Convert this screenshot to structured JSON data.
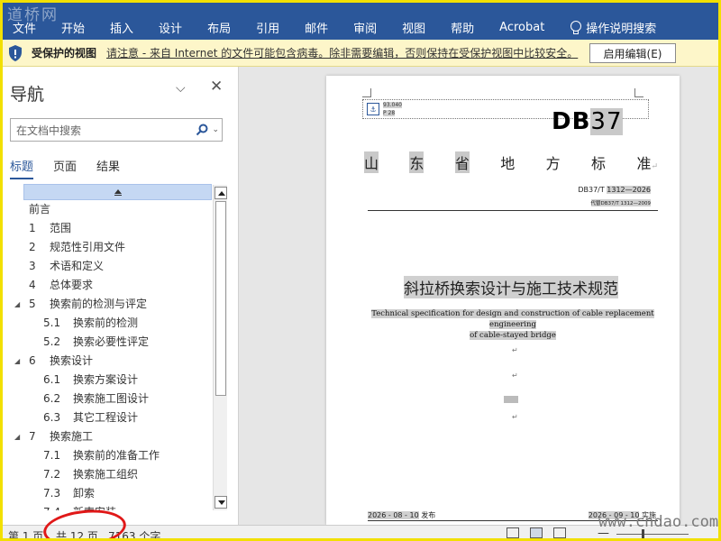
{
  "ribbon": {
    "watermark": "道桥网",
    "tabs": [
      "文件",
      "开始",
      "插入",
      "设计",
      "布局",
      "引用",
      "邮件",
      "审阅",
      "视图",
      "帮助",
      "Acrobat"
    ],
    "help_label": "操作说明搜索",
    "color": "#2b579a"
  },
  "protected_bar": {
    "title": "受保护的视图",
    "message": "请注意 - 来自 Internet 的文件可能包含病毒。除非需要编辑，否则保持在受保护视图中比较安全。",
    "button": "启用编辑(E)",
    "color": "#fdf6c9"
  },
  "nav": {
    "title": "导航",
    "search_placeholder": "在文档中搜索",
    "tabs": [
      "标题",
      "页面",
      "结果"
    ],
    "active_tab": "标题",
    "items": [
      {
        "num": "",
        "label": "前言",
        "level": 0,
        "expander": ""
      },
      {
        "num": "1",
        "label": "范围",
        "level": 0,
        "expander": ""
      },
      {
        "num": "2",
        "label": "规范性引用文件",
        "level": 0,
        "expander": ""
      },
      {
        "num": "3",
        "label": "术语和定义",
        "level": 0,
        "expander": ""
      },
      {
        "num": "4",
        "label": "总体要求",
        "level": 0,
        "expander": ""
      },
      {
        "num": "5",
        "label": "换索前的检测与评定",
        "level": 0,
        "expander": "◢"
      },
      {
        "num": "5.1",
        "label": "换索前的检测",
        "level": 1,
        "expander": ""
      },
      {
        "num": "5.2",
        "label": "换索必要性评定",
        "level": 1,
        "expander": ""
      },
      {
        "num": "6",
        "label": "换索设计",
        "level": 0,
        "expander": "◢"
      },
      {
        "num": "6.1",
        "label": "换索方案设计",
        "level": 1,
        "expander": ""
      },
      {
        "num": "6.2",
        "label": "换索施工图设计",
        "level": 1,
        "expander": ""
      },
      {
        "num": "6.3",
        "label": "其它工程设计",
        "level": 1,
        "expander": ""
      },
      {
        "num": "7",
        "label": "换索施工",
        "level": 0,
        "expander": "◢"
      },
      {
        "num": "7.1",
        "label": "换索前的准备工作",
        "level": 1,
        "expander": ""
      },
      {
        "num": "7.2",
        "label": "换索施工组织",
        "level": 1,
        "expander": ""
      },
      {
        "num": "7.3",
        "label": "卸索",
        "level": 1,
        "expander": ""
      },
      {
        "num": "7.4",
        "label": "新索安装",
        "level": 1,
        "expander": ""
      }
    ]
  },
  "document": {
    "ics": "93.040",
    "ccs": "P 28",
    "db_label": "DB",
    "db_num": "37",
    "province": [
      "山",
      "东",
      "省",
      "地",
      "方",
      "标",
      "准"
    ],
    "standard_code_prefix": "DB37/T ",
    "standard_code": "1312—2026",
    "replaces": "代替DB37/T 1312—2009",
    "cn_title": "斜拉桥换索设计与施工技术规范",
    "en_title_1": "Technical specification for design and construction of cable replacement engineering",
    "en_title_2": "of cable-stayed bridge",
    "issue_date": "2026 - 08 - 10",
    "issue_label": "发布",
    "implement_date": "2026 - 09 - 10",
    "implement_label": "实施",
    "para_mark": "↵"
  },
  "status": {
    "page": "第 1 页",
    "total": "共 12 页",
    "words": "7163 个字",
    "minus": "—"
  },
  "watermark_bottom": "www.cndao.com",
  "highlight_color": "#e01818"
}
